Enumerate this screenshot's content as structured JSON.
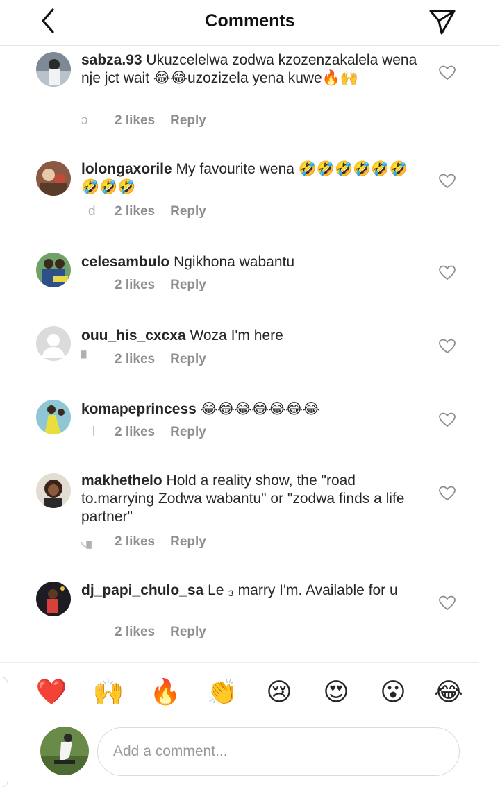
{
  "header": {
    "title": "Comments",
    "back_icon": "chevron-left-icon",
    "send_icon": "paper-plane-icon"
  },
  "comments": [
    {
      "username": "sabza.93",
      "text": "Ukuzcelelwa zodwa kzozenzakalela wena nje jct wait 😂😂uzozizela yena kuwe🔥🙌",
      "time": "ɔ",
      "likes": "2 likes",
      "reply": "Reply"
    },
    {
      "username": "lolongaxorile",
      "text": "My favourite wena 🤣🤣🤣🤣🤣🤣🤣🤣🤣",
      "time": "d",
      "likes": "2 likes",
      "reply": "Reply"
    },
    {
      "username": "celesambulo",
      "text": "Ngikhona wabantu",
      "time": "",
      "likes": "2 likes",
      "reply": "Reply"
    },
    {
      "username": "ouu_his_cxcxa",
      "text": "Woza I'm here",
      "time": "▘",
      "likes": "2 likes",
      "reply": "Reply"
    },
    {
      "username": "komapeprincess",
      "text": "😂😂😂😂😂😂😂",
      "time": "l",
      "likes": "2 likes",
      "reply": "Reply"
    },
    {
      "username": "makhethelo",
      "text": "Hold a reality show, the \"road to.marrying Zodwa wabantu\" or \"zodwa finds a life partner\"",
      "time": "◟▖",
      "likes": "2 likes",
      "reply": "Reply"
    },
    {
      "username": "dj_papi_chulo_sa",
      "text": "Le  ₃ marry I'm. Available for u",
      "time": "",
      "likes": "2 likes",
      "reply": "Reply"
    }
  ],
  "emoji_bar": [
    "❤️",
    "🙌",
    "🔥",
    "👏",
    "😢",
    "😍",
    "😮",
    "😂"
  ],
  "composer": {
    "placeholder": "Add a comment..."
  },
  "colors": {
    "text": "#262626",
    "muted": "#8e8e8e",
    "border": "#dbdbdb"
  }
}
